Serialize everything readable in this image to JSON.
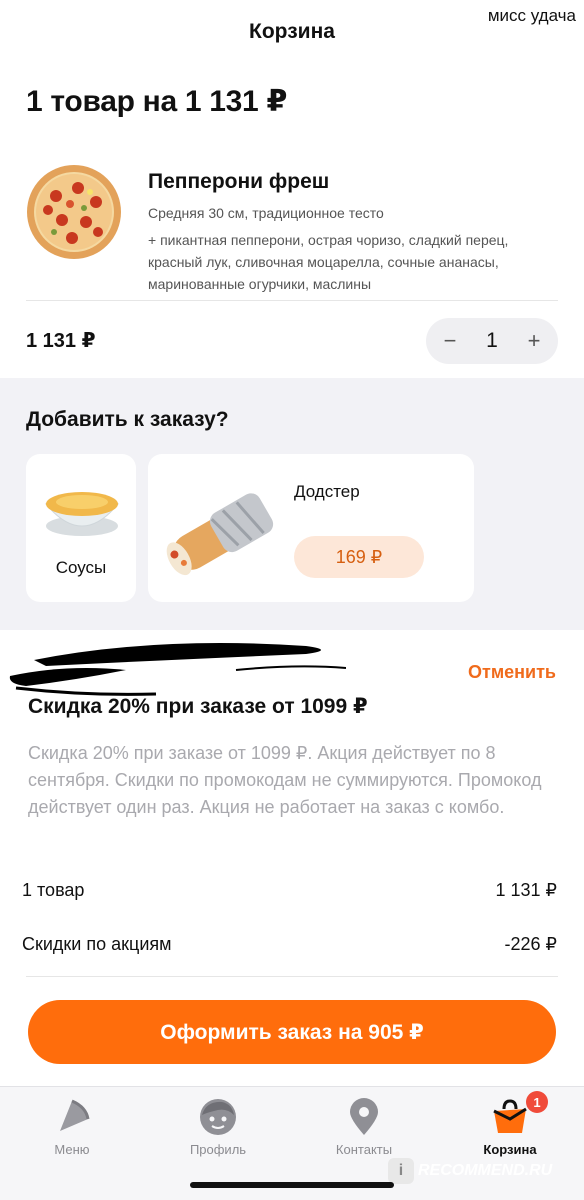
{
  "watermark_top": "мисс удача",
  "header": {
    "title": "Корзина"
  },
  "summary": {
    "title": "1 товар на 1 131 ₽"
  },
  "product": {
    "name": "Пепперони фреш",
    "size": "Средняя 30 см, традиционное тесто",
    "extras": "+ пикантная пепперони, острая чоризо, сладкий перец, красный лук, сливочная моцарелла, сочные ананасы, маринованные огурчики, маслины",
    "price": "1 131 ₽",
    "quantity": "1",
    "minus_icon": "−",
    "plus_icon": "+"
  },
  "upsell": {
    "title": "Добавить к заказу?",
    "items": [
      {
        "name": "Соусы"
      },
      {
        "name": "Додстер",
        "price": "169 ₽"
      }
    ]
  },
  "promo": {
    "cancel_label": "Отменить",
    "title": "Скидка 20% при заказе от 1099 ₽",
    "description": "Скидка 20% при заказе от 1099 ₽. Акция действует по 8 сентября. Скидки по промокодам не суммируются. Промокод действует один раз. Акция не работает на заказ с комбо."
  },
  "totals": [
    {
      "label": "1 товар",
      "value": "1 131 ₽"
    },
    {
      "label": "Скидки по акциям",
      "value": "-226 ₽"
    }
  ],
  "checkout": {
    "label": "Оформить заказ на 905 ₽"
  },
  "tabbar": {
    "items": [
      {
        "label": "Меню",
        "icon": "pizza-slice-icon"
      },
      {
        "label": "Профиль",
        "icon": "profile-face-icon"
      },
      {
        "label": "Контакты",
        "icon": "map-pin-icon"
      },
      {
        "label": "Корзина",
        "icon": "cart-bag-icon",
        "badge": "1",
        "active": true
      }
    ]
  },
  "colors": {
    "accent": "#ff6d0c",
    "price_chip_bg": "#fde7d8",
    "price_chip_text": "#d65f10",
    "badge": "#f04b3a"
  },
  "watermark_bottom": "RECOMMEND.RU"
}
